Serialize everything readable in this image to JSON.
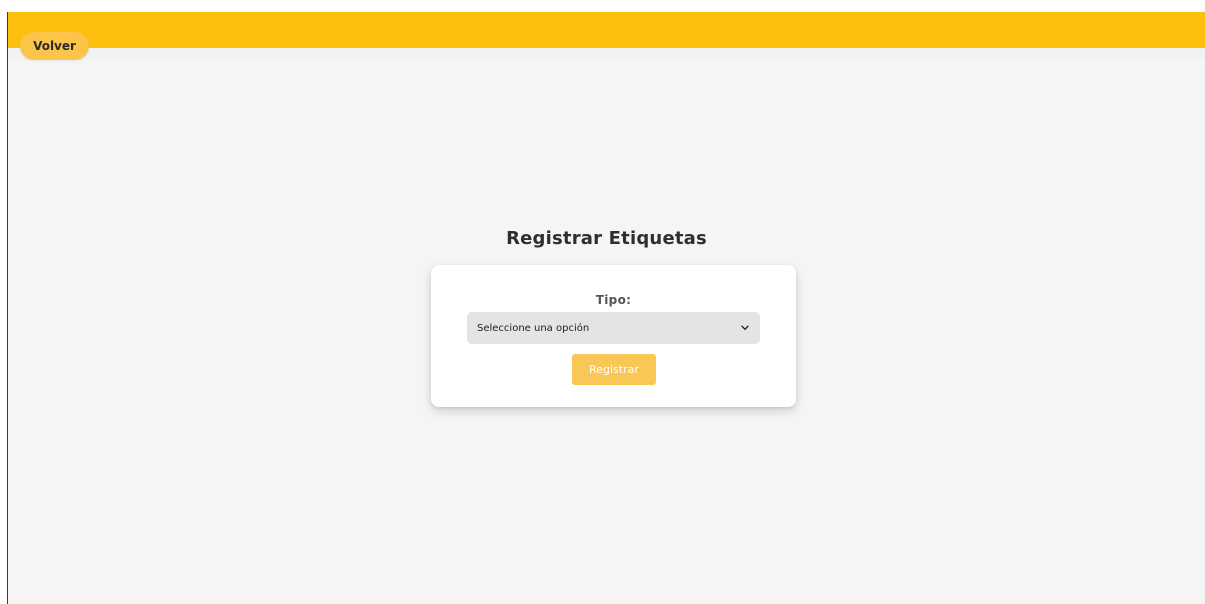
{
  "header": {
    "back_label": "Volver",
    "bar_color": "#fdc00f"
  },
  "main": {
    "title": "Registrar Etiquetas"
  },
  "form": {
    "tipo_label": "Tipo:",
    "tipo_select": {
      "selected": "Seleccione una opción",
      "icon": "chevron-down-icon"
    },
    "submit_label": "Registrar",
    "submit_color": "#f8c756"
  }
}
